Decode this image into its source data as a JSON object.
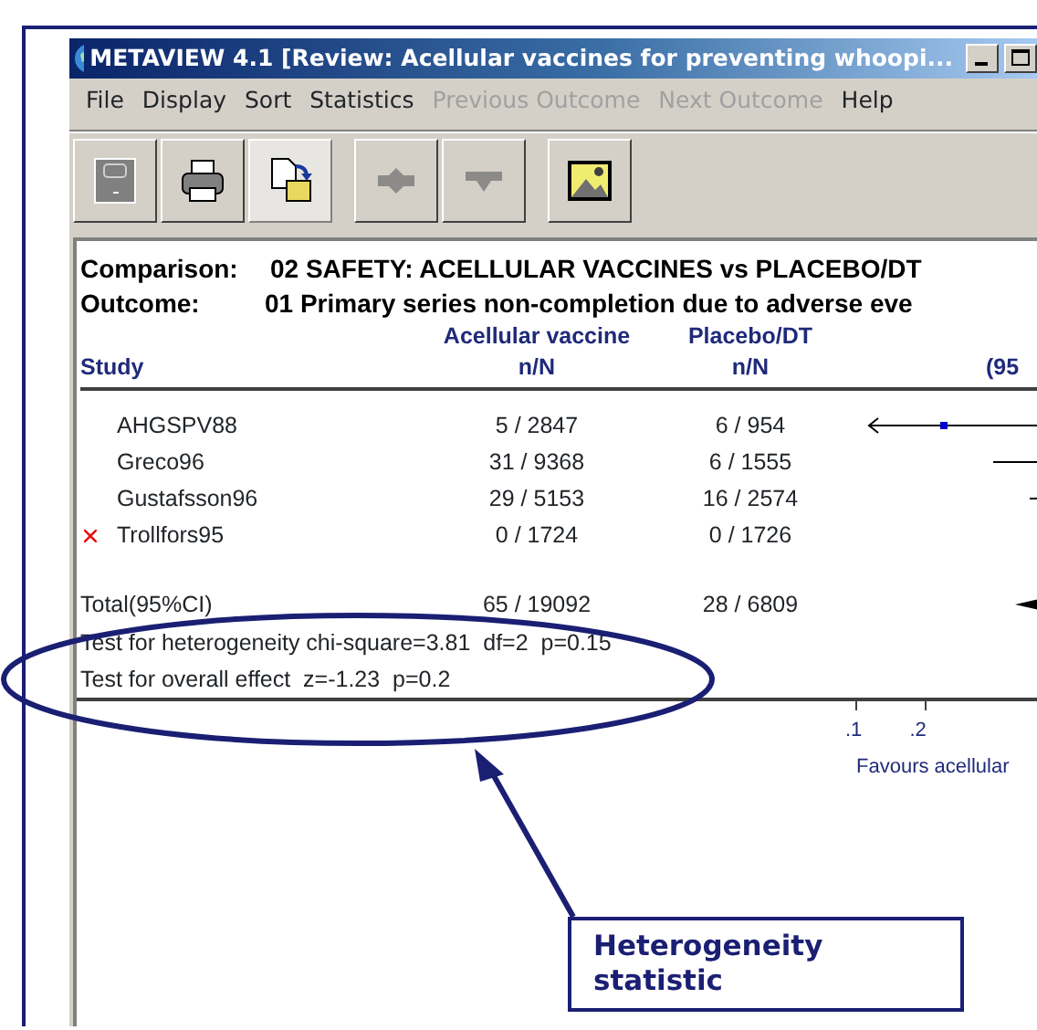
{
  "window": {
    "title": "METAVIEW 4.1 [Review: Acellular vaccines for preventing whoopi..."
  },
  "menu": [
    {
      "label": "File",
      "disabled": false
    },
    {
      "label": "Display",
      "disabled": false
    },
    {
      "label": "Sort",
      "disabled": false
    },
    {
      "label": "Statistics",
      "disabled": false
    },
    {
      "label": "Previous Outcome",
      "disabled": true
    },
    {
      "label": "Next Outcome",
      "disabled": true
    },
    {
      "label": "Help",
      "disabled": false
    }
  ],
  "toolbar": [
    {
      "kind": "disk",
      "disabled": false,
      "pressed": false
    },
    {
      "kind": "printer",
      "disabled": false,
      "pressed": false
    },
    {
      "kind": "copy",
      "disabled": false,
      "pressed": true
    },
    {
      "kind": "up",
      "disabled": true,
      "pressed": false
    },
    {
      "kind": "down",
      "disabled": true,
      "pressed": false
    },
    {
      "kind": "picture",
      "disabled": false,
      "pressed": false
    }
  ],
  "report": {
    "comparison_label": "Comparison:",
    "comparison": "02 SAFETY: ACELLULAR VACCINES vs PLACEBO/DT",
    "outcome_label": "Outcome:",
    "outcome": "01 Primary series non-completion due to adverse eve",
    "columns": [
      {
        "line2": "Study"
      },
      {
        "line1": "Acellular vaccine",
        "line2": "n/N"
      },
      {
        "line1": "Placebo/DT",
        "line2": "n/N"
      },
      {
        "line2": "(95"
      }
    ],
    "rows": [
      {
        "study": "AHGSPV88",
        "excluded": false,
        "treatment": "5 / 2847",
        "control": "6 / 954"
      },
      {
        "study": "Greco96",
        "excluded": false,
        "treatment": "31 / 9368",
        "control": "6 / 1555"
      },
      {
        "study": "Gustafsson96",
        "excluded": false,
        "treatment": "29 / 5153",
        "control": "16 / 2574"
      },
      {
        "study": "Trollfors95",
        "excluded": true,
        "treatment": "0 / 1724",
        "control": "0 / 1726"
      }
    ],
    "total": {
      "study": "Total(95%CI)",
      "treatment": "65 / 19092",
      "control": "28 / 6809"
    },
    "tests": [
      "Test for heterogeneity chi-square=3.81  df=2  p=0.15",
      "Test for overall effect  z=-1.23  p=0.2"
    ],
    "axis_ticks": [
      ".1",
      ".2"
    ],
    "axis_label": "Favours acellular"
  },
  "callout": {
    "text": "Heterogeneity statistic"
  }
}
